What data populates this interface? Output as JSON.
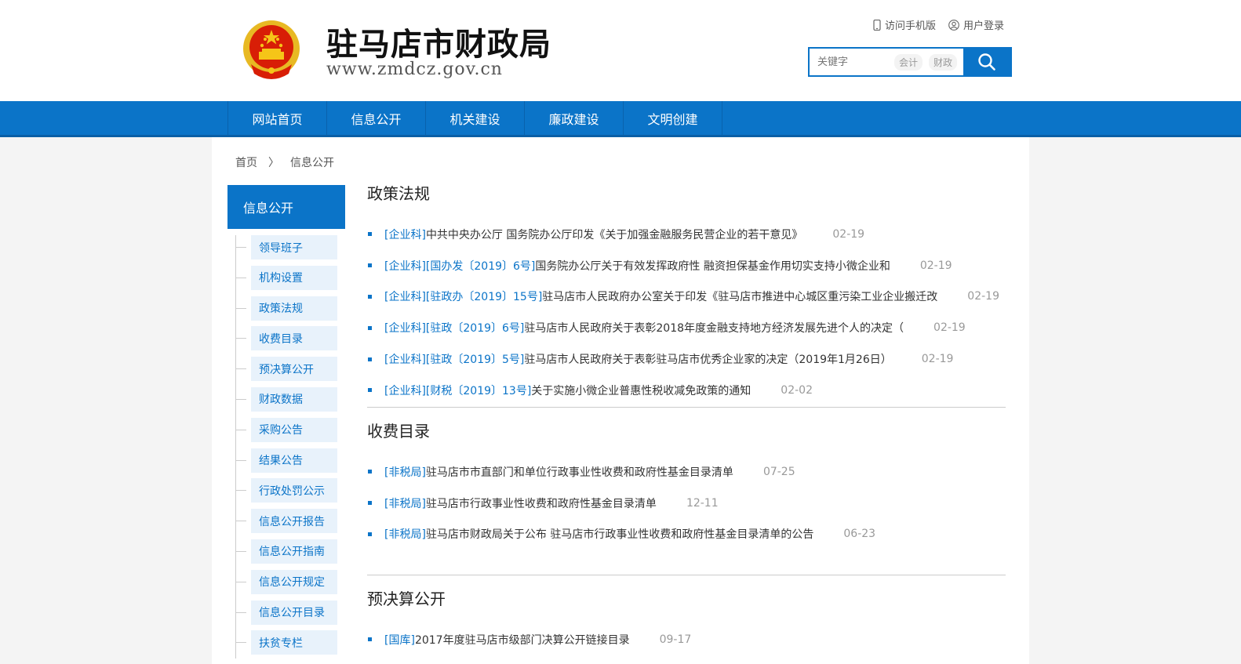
{
  "header": {
    "site_title": "驻马店市财政局",
    "site_url": "www.zmdcz.gov.cn",
    "mobile_link": "访问手机版",
    "login_link": "用户登录",
    "search_placeholder": "关键字",
    "hot_tags": [
      "会计",
      "财政"
    ]
  },
  "nav": {
    "items": [
      "网站首页",
      "信息公开",
      "机关建设",
      "廉政建设",
      "文明创建"
    ]
  },
  "breadcrumb": {
    "home": "首页",
    "separator": "〉",
    "current": "信息公开"
  },
  "sidebar": {
    "title": "信息公开",
    "items": [
      "领导班子",
      "机构设置",
      "政策法规",
      "收费目录",
      "预决算公开",
      "财政数据",
      "采购公告",
      "结果公告",
      "行政处罚公示",
      "信息公开报告",
      "信息公开指南",
      "信息公开规定",
      "信息公开目录",
      "扶贫专栏"
    ]
  },
  "sections": [
    {
      "title": "政策法规",
      "items": [
        {
          "tag": "[企业科]",
          "title": "中共中央办公厅 国务院办公厅印发《关于加强金融服务民营企业的若干意见》",
          "date": "02-19"
        },
        {
          "tag": "[企业科][国办发〔2019〕6号]",
          "title": "国务院办公厅关于有效发挥政府性 融资担保基金作用切实支持小微企业和",
          "date": "02-19"
        },
        {
          "tag": "[企业科][驻政办〔2019〕15号]",
          "title": "驻马店市人民政府办公室关于印发《驻马店市推进中心城区重污染工业企业搬迁改",
          "date": "02-19"
        },
        {
          "tag": "[企业科][驻政〔2019〕6号]",
          "title": "驻马店市人民政府关于表彰2018年度金融支持地方经济发展先进个人的决定（",
          "date": "02-19"
        },
        {
          "tag": "[企业科][驻政〔2019〕5号]",
          "title": "驻马店市人民政府关于表彰驻马店市优秀企业家的决定（2019年1月26日）",
          "date": "02-19"
        },
        {
          "tag": "[企业科][财税〔2019〕13号]",
          "title": "关于实施小微企业普惠性税收减免政策的通知",
          "date": "02-02"
        }
      ]
    },
    {
      "title": "收费目录",
      "items": [
        {
          "tag": "[非税局]",
          "title": "驻马店市市直部门和单位行政事业性收费和政府性基金目录清单",
          "date": "07-25"
        },
        {
          "tag": "[非税局]",
          "title": " 驻马店市行政事业性收费和政府性基金目录清单",
          "date": "12-11"
        },
        {
          "tag": "[非税局]",
          "title": "驻马店市财政局关于公布 驻马店市行政事业性收费和政府性基金目录清单的公告",
          "date": "06-23"
        }
      ]
    },
    {
      "title": "预决算公开",
      "items": [
        {
          "tag": "[国库]",
          "title": "2017年度驻马店市级部门决算公开链接目录",
          "date": "09-17"
        }
      ]
    }
  ],
  "colors": {
    "accent": "#0b74c8",
    "emblem_red": "#d81e06",
    "emblem_gold": "#f5c518"
  }
}
